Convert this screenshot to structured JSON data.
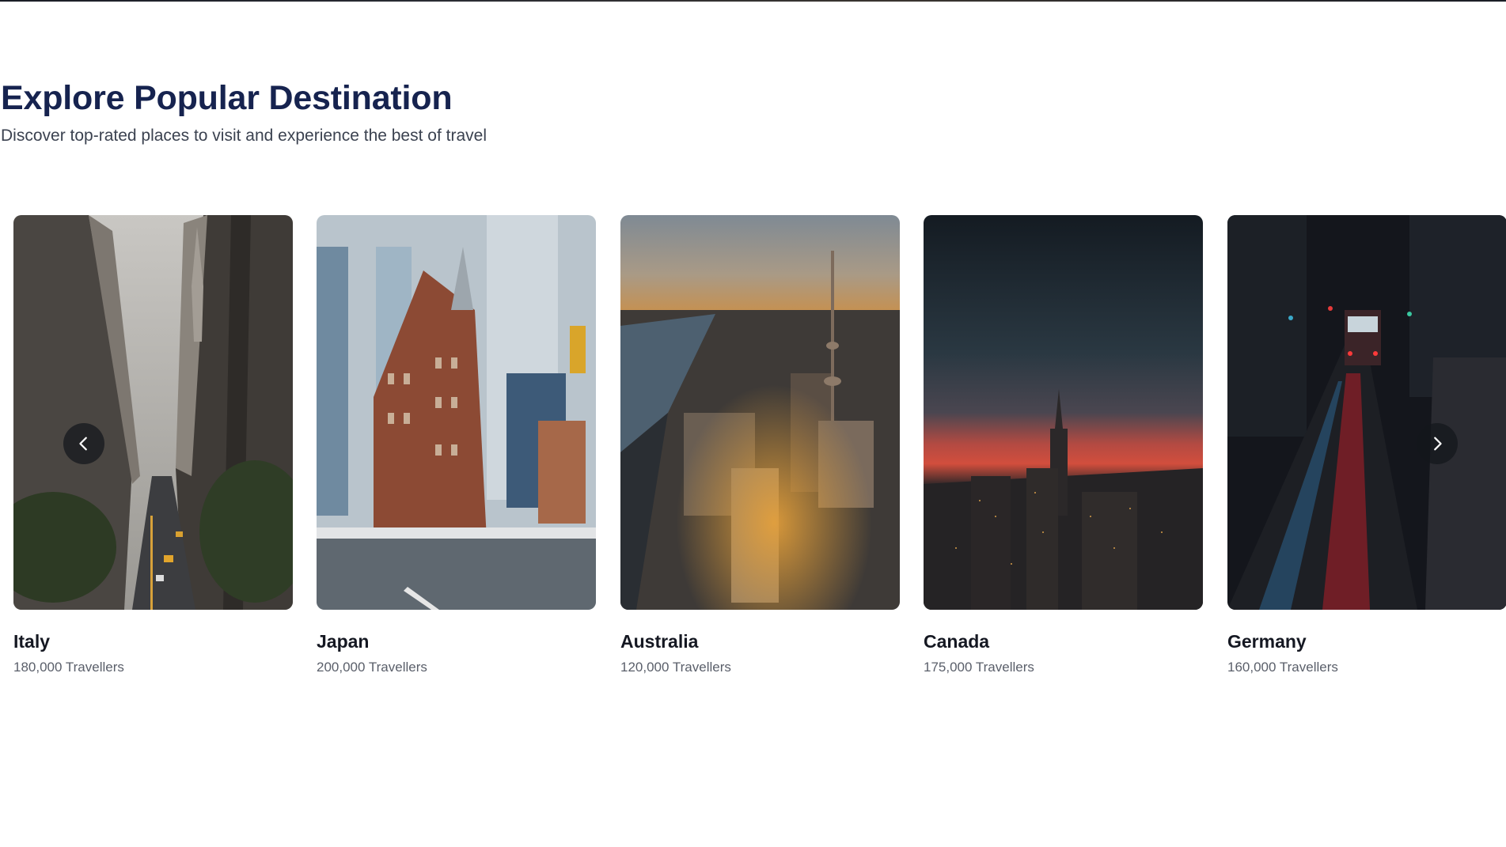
{
  "section": {
    "title": "Explore Popular Destination",
    "subtitle": "Discover top-rated places to visit and experience the best of travel"
  },
  "destinations": [
    {
      "name": "Italy",
      "travellers": "180,000 Travellers",
      "scene": "city-street-skyscrapers"
    },
    {
      "name": "Japan",
      "travellers": "200,000 Travellers",
      "scene": "red-brick-flatiron-building"
    },
    {
      "name": "Australia",
      "travellers": "120,000 Travellers",
      "scene": "aerial-city-tower-sunset"
    },
    {
      "name": "Canada",
      "travellers": "175,000 Travellers",
      "scene": "skyline-dusk"
    },
    {
      "name": "Germany",
      "travellers": "160,000 Travellers",
      "scene": "night-street-tram"
    }
  ],
  "carousel": {
    "prev_icon": "chevron-left-icon",
    "next_icon": "chevron-right-icon"
  },
  "colors": {
    "heading": "#16234f",
    "text": "#151822",
    "muted": "#5a5f6a"
  }
}
